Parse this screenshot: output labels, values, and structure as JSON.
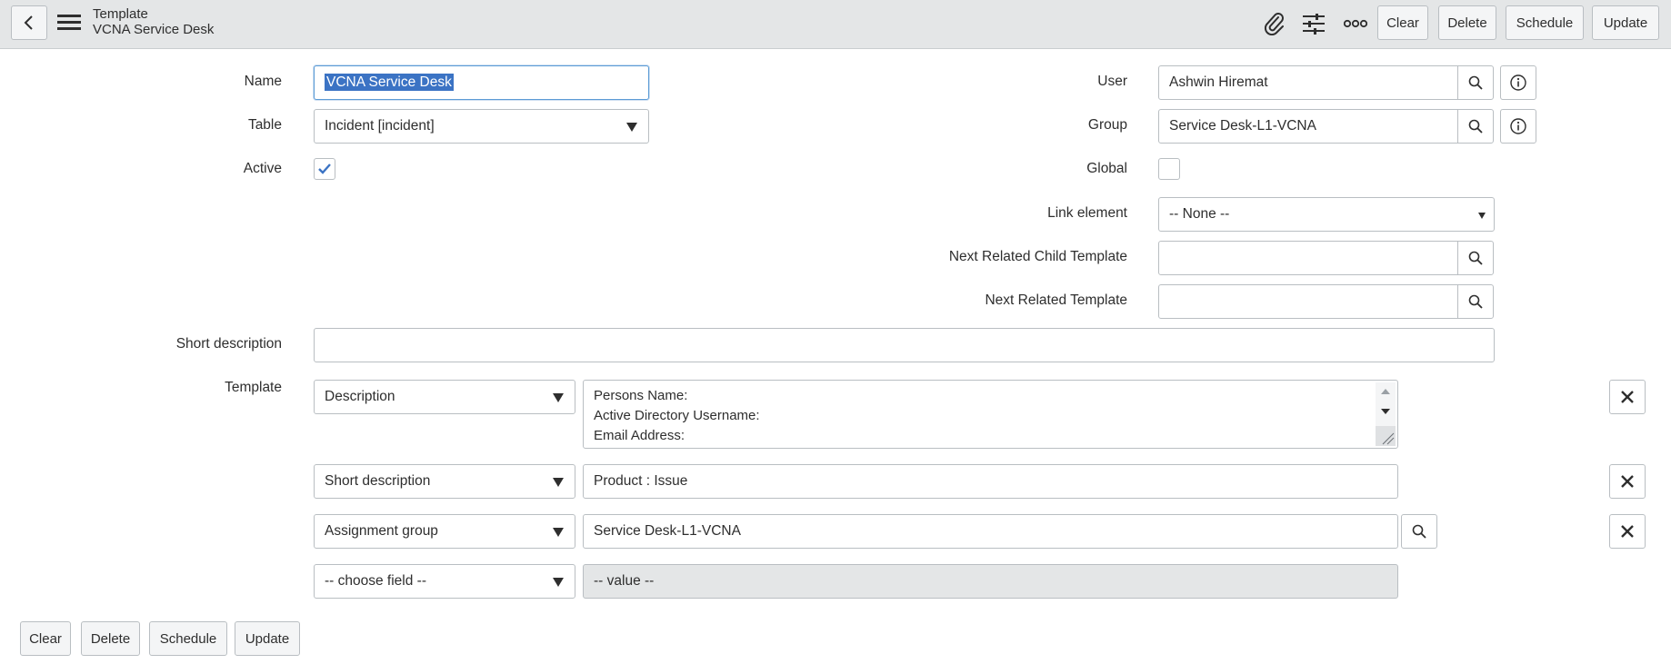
{
  "header": {
    "title": "Template",
    "subtitle": "VCNA Service Desk",
    "buttons": {
      "clear": "Clear",
      "delete": "Delete",
      "schedule": "Schedule",
      "update": "Update"
    }
  },
  "form": {
    "name": {
      "label": "Name",
      "value": "VCNA Service Desk"
    },
    "table": {
      "label": "Table",
      "value": "Incident [incident]"
    },
    "active": {
      "label": "Active",
      "checked": true
    },
    "user": {
      "label": "User",
      "value": "Ashwin Hiremat"
    },
    "group": {
      "label": "Group",
      "value": "Service Desk-L1-VCNA"
    },
    "global": {
      "label": "Global",
      "checked": false
    },
    "link_element": {
      "label": "Link element",
      "value": "-- None --"
    },
    "next_related_child": {
      "label": "Next Related Child Template",
      "value": ""
    },
    "next_related": {
      "label": "Next Related Template",
      "value": ""
    },
    "short_description": {
      "label": "Short description",
      "value": ""
    },
    "template_label": "Template",
    "template_rows": [
      {
        "field": "Description",
        "lines": [
          "Persons Name:",
          "Active Directory Username:",
          "Email Address:"
        ]
      },
      {
        "field": "Short description",
        "value": "Product : Issue"
      },
      {
        "field": "Assignment group",
        "value": "Service Desk-L1-VCNA"
      },
      {
        "field": "-- choose field --",
        "value": "-- value --"
      }
    ]
  },
  "footer": {
    "clear": "Clear",
    "delete": "Delete",
    "schedule": "Schedule",
    "update": "Update"
  }
}
